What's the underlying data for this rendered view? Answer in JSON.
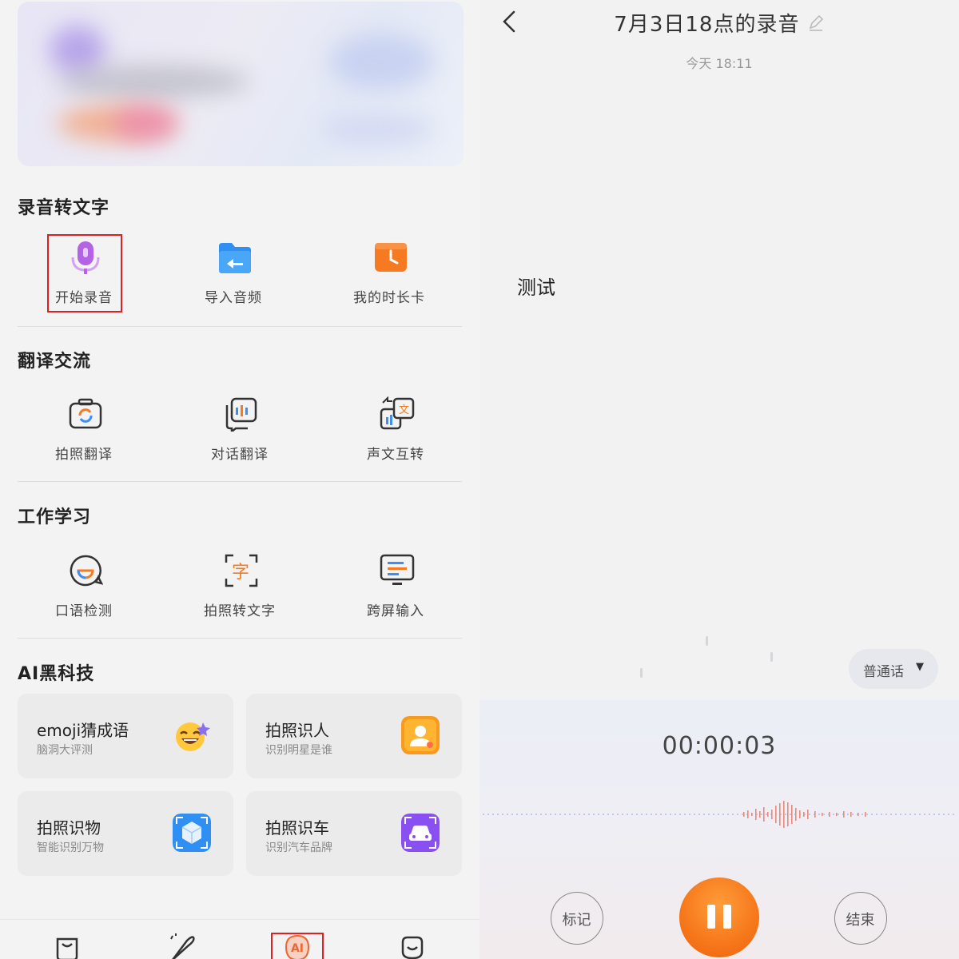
{
  "left": {
    "sections": {
      "recording": {
        "title": "录音转文字",
        "tools": [
          {
            "label": "开始录音",
            "icon": "microphone-icon"
          },
          {
            "label": "导入音频",
            "icon": "folder-icon"
          },
          {
            "label": "我的时长卡",
            "icon": "clock-card-icon"
          }
        ]
      },
      "translate": {
        "title": "翻译交流",
        "tools": [
          {
            "label": "拍照翻译",
            "icon": "camera-translate-icon"
          },
          {
            "label": "对话翻译",
            "icon": "dialog-translate-icon"
          },
          {
            "label": "声文互转",
            "icon": "voice-text-convert-icon"
          }
        ]
      },
      "work": {
        "title": "工作学习",
        "tools": [
          {
            "label": "口语检测",
            "icon": "speech-check-icon"
          },
          {
            "label": "拍照转文字",
            "icon": "photo-text-icon"
          },
          {
            "label": "跨屏输入",
            "icon": "screen-input-icon"
          }
        ]
      },
      "ai": {
        "title": "AI黑科技",
        "cards": [
          {
            "title": "emoji猜成语",
            "subtitle": "脑洞大评测",
            "icon": "emoji-icon"
          },
          {
            "title": "拍照识人",
            "subtitle": "识别明星是谁",
            "icon": "person-id-icon"
          },
          {
            "title": "拍照识物",
            "subtitle": "智能识别万物",
            "icon": "object-cube-icon"
          },
          {
            "title": "拍照识车",
            "subtitle": "识别汽车品牌",
            "icon": "car-icon"
          }
        ]
      }
    },
    "bottom_nav": {
      "ai_label": "AI",
      "icons": [
        "bag-icon",
        "feather-icon",
        "ai-icon",
        "smile-icon"
      ]
    }
  },
  "right": {
    "title": "7月3日18点的录音",
    "time": "今天 18:11",
    "transcript": "测试",
    "language": "普通话",
    "timer": "00:00:03",
    "mark_label": "标记",
    "end_label": "结束"
  },
  "colors": {
    "accent_orange": "#f6771a",
    "highlight_red": "#e02020",
    "mic_purple": "#b463e6",
    "folder_blue": "#2f8ff2"
  }
}
